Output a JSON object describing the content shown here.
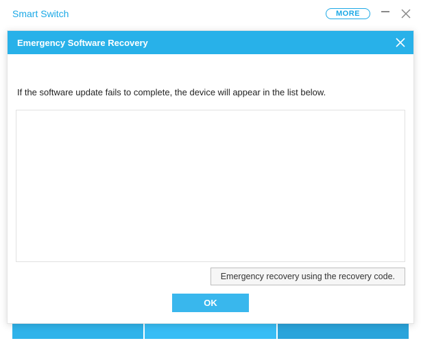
{
  "header": {
    "app_title": "Smart Switch",
    "more_label": "MORE"
  },
  "dialog": {
    "title": "Emergency Software Recovery",
    "instruction": "If the software update fails to complete, the device will appear in the list below.",
    "recovery_code_button": "Emergency recovery using the recovery code.",
    "ok_label": "OK"
  }
}
